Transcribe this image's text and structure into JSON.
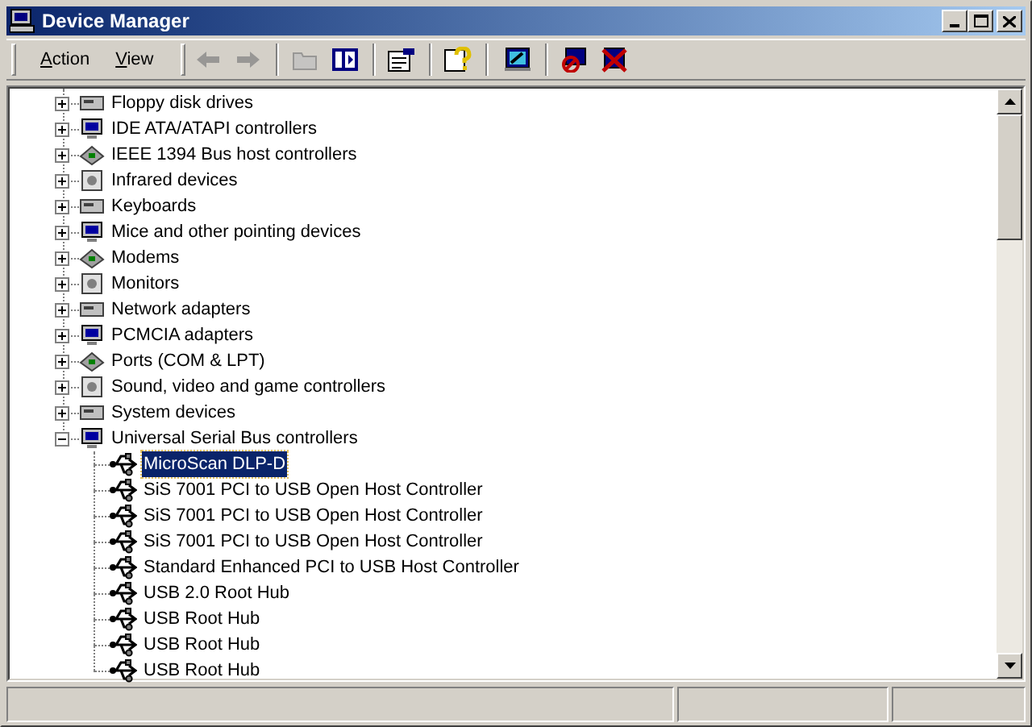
{
  "window": {
    "title": "Device Manager"
  },
  "menu": [
    {
      "label": "Action"
    },
    {
      "label": "View"
    }
  ],
  "toolbar": [
    {
      "kind": "back",
      "disabled": true
    },
    {
      "kind": "forward",
      "disabled": true
    },
    {
      "kind": "folder",
      "disabled": true
    },
    {
      "kind": "panel",
      "disabled": false
    },
    {
      "kind": "properties",
      "disabled": false
    },
    {
      "kind": "help",
      "disabled": false
    },
    {
      "kind": "scan",
      "disabled": false
    },
    {
      "kind": "disable",
      "disabled": false
    },
    {
      "kind": "uninstall",
      "disabled": false
    }
  ],
  "tree": [
    {
      "label": "Floppy disk drives",
      "expanded": false,
      "selected": false
    },
    {
      "label": "IDE ATA/ATAPI controllers",
      "expanded": false,
      "selected": false
    },
    {
      "label": "IEEE 1394 Bus host controllers",
      "expanded": false,
      "selected": false
    },
    {
      "label": "Infrared devices",
      "expanded": false,
      "selected": false
    },
    {
      "label": "Keyboards",
      "expanded": false,
      "selected": false
    },
    {
      "label": "Mice and other pointing devices",
      "expanded": false,
      "selected": false
    },
    {
      "label": "Modems",
      "expanded": false,
      "selected": false
    },
    {
      "label": "Monitors",
      "expanded": false,
      "selected": false
    },
    {
      "label": "Network adapters",
      "expanded": false,
      "selected": false
    },
    {
      "label": "PCMCIA adapters",
      "expanded": false,
      "selected": false
    },
    {
      "label": "Ports (COM & LPT)",
      "expanded": false,
      "selected": false
    },
    {
      "label": "Sound, video and game controllers",
      "expanded": false,
      "selected": false
    },
    {
      "label": "System devices",
      "expanded": false,
      "selected": false
    },
    {
      "label": "Universal Serial Bus controllers",
      "expanded": true,
      "selected": false,
      "children": [
        {
          "label": "MicroScan DLP-D",
          "selected": true
        },
        {
          "label": "SiS 7001 PCI to USB Open Host Controller",
          "selected": false
        },
        {
          "label": "SiS 7001 PCI to USB Open Host Controller",
          "selected": false
        },
        {
          "label": "SiS 7001 PCI to USB Open Host Controller",
          "selected": false
        },
        {
          "label": "Standard Enhanced PCI to USB Host Controller",
          "selected": false
        },
        {
          "label": "USB 2.0 Root Hub",
          "selected": false
        },
        {
          "label": "USB Root Hub",
          "selected": false
        },
        {
          "label": "USB Root Hub",
          "selected": false
        },
        {
          "label": "USB Root Hub",
          "selected": false
        }
      ]
    }
  ]
}
